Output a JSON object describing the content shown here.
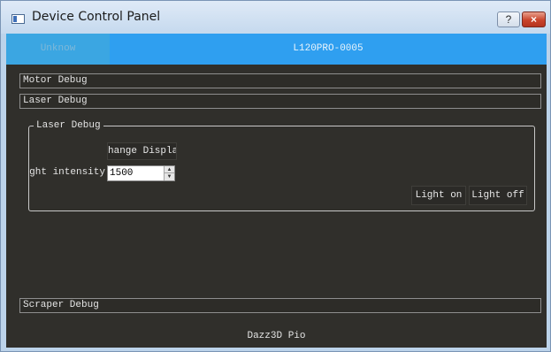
{
  "window": {
    "title": "Device Control Panel",
    "help_label": "?",
    "close_label": "×"
  },
  "tabs": [
    {
      "label": "Unknow"
    },
    {
      "label": "L120PRO-0005"
    }
  ],
  "sections": {
    "motor": "Motor Debug",
    "laser": "Laser Debug",
    "scraper": "Scraper Debug"
  },
  "laser_group": {
    "title": "Laser Debug",
    "change_display_label": "hange Displa",
    "intensity_label": "ght intensity",
    "intensity_value": "1500",
    "light_on_label": "Light on",
    "light_off_label": "Light off"
  },
  "footer": {
    "text": "Dazz3D Pio"
  },
  "colors": {
    "tab_active": "#2f9ff0",
    "tab_inactive": "#3ba6e2",
    "panel_bg": "#302f2b",
    "close_red": "#c9442c"
  }
}
